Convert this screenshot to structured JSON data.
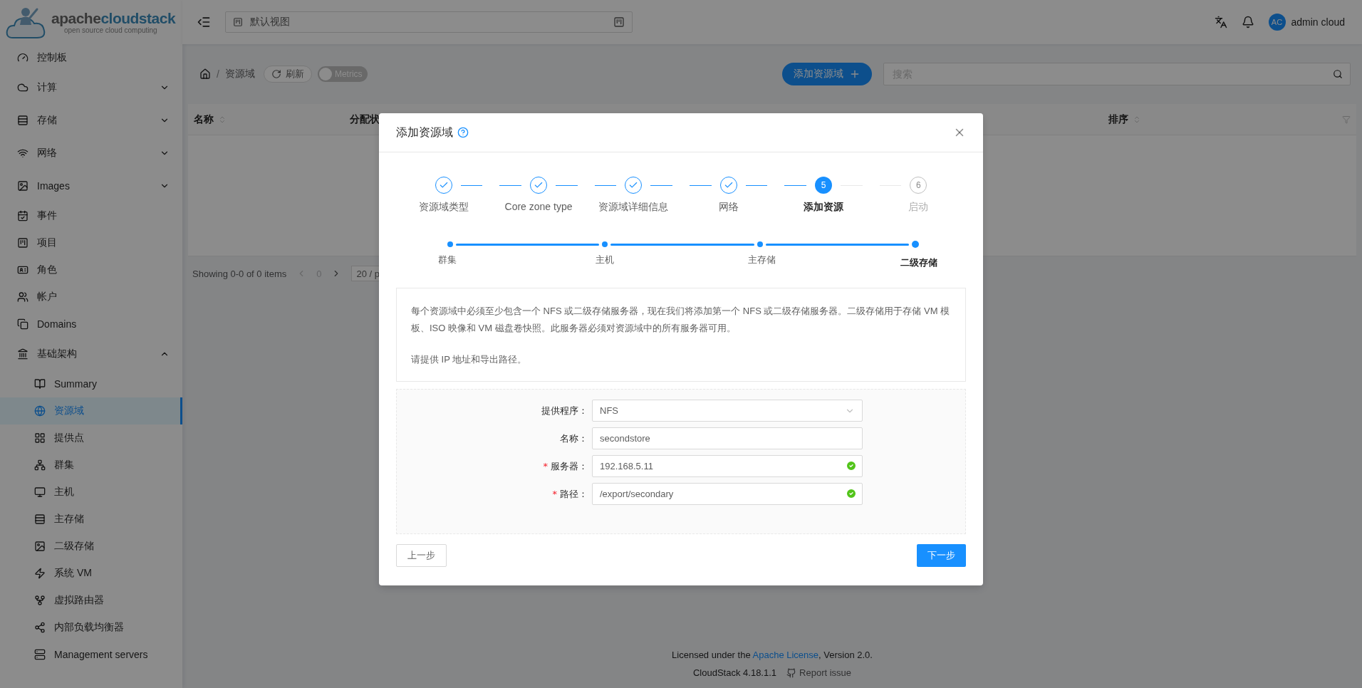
{
  "sidebar": {
    "logo": {
      "word_part1": "apache",
      "word_part2": "cloudstack",
      "tagline": "open source cloud computing"
    },
    "items": [
      {
        "label": "控制板",
        "selected": false
      },
      {
        "label": "计算",
        "selected": false,
        "expanded": false
      },
      {
        "label": "存储",
        "selected": false,
        "expanded": false
      },
      {
        "label": "网络",
        "selected": false,
        "expanded": false
      },
      {
        "label": "Images",
        "selected": false,
        "expanded": false
      },
      {
        "label": "事件",
        "selected": false
      },
      {
        "label": "项目",
        "selected": false
      },
      {
        "label": "角色",
        "selected": false
      },
      {
        "label": "帐户",
        "selected": false
      },
      {
        "label": "Domains",
        "selected": false
      },
      {
        "label": "基础架构",
        "selected": false,
        "expanded": true,
        "children": [
          {
            "label": "Summary",
            "selected": false
          },
          {
            "label": "资源域",
            "selected": true
          },
          {
            "label": "提供点",
            "selected": false
          },
          {
            "label": "群集",
            "selected": false
          },
          {
            "label": "主机",
            "selected": false
          },
          {
            "label": "主存储",
            "selected": false
          },
          {
            "label": "二级存储",
            "selected": false
          },
          {
            "label": "系统 VM",
            "selected": false
          },
          {
            "label": "虚拟路由器",
            "selected": false
          },
          {
            "label": "内部负载均衡器",
            "selected": false
          },
          {
            "label": "Management servers",
            "selected": false
          }
        ]
      }
    ]
  },
  "header": {
    "view_selector": {
      "value": "默认视图"
    },
    "user": {
      "initials": "AC",
      "name": "admin cloud"
    }
  },
  "toolbar": {
    "breadcrumb_separator": "/",
    "breadcrumb": [
      "资源域"
    ],
    "refresh": "刷新",
    "metrics": {
      "label": "Metrics",
      "on": false
    },
    "add_button": "添加资源域",
    "search": {
      "placeholder": "搜索"
    }
  },
  "table": {
    "columns": [
      {
        "label": "名称"
      },
      {
        "label": "分配状"
      },
      {
        "label": "排序"
      }
    ],
    "pagination": {
      "summary": "Showing 0-0 of 0 items",
      "page": "0",
      "page_size": "20 / p"
    }
  },
  "footer": {
    "license_before": "Licensed under the ",
    "license_link": "Apache License",
    "license_after": ", Version 2.0.",
    "version": "CloudStack 4.18.1.1",
    "report": "Report issue"
  },
  "modal": {
    "title": "添加资源域",
    "steps": [
      {
        "label": "资源域类型",
        "done": true,
        "current": false
      },
      {
        "label": "Core zone type",
        "done": true,
        "current": false
      },
      {
        "label": "资源域详细信息",
        "done": true,
        "current": false
      },
      {
        "label": "网络",
        "done": true,
        "current": false
      },
      {
        "label": "添加资源",
        "done": false,
        "current": true,
        "number": "5"
      },
      {
        "label": "启动",
        "done": false,
        "current": false,
        "number": "6"
      }
    ],
    "substeps": [
      {
        "label": "群集",
        "selected": false
      },
      {
        "label": "主机",
        "selected": false
      },
      {
        "label": "主存储",
        "selected": false
      },
      {
        "label": "二级存储",
        "selected": true
      }
    ],
    "description": [
      "每个资源域中必须至少包含一个 NFS 或二级存储服务器，现在我们将添加第一个 NFS 或二级存储服务器。二级存储用于存储 VM 模板、ISO 映像和 VM 磁盘卷快照。此服务器必须对资源域中的所有服务器可用。",
      "请提供 IP 地址和导出路径。"
    ],
    "fields": [
      {
        "kind": "select",
        "label": "提供程序：",
        "value": "NFS",
        "valid": false
      },
      {
        "kind": "input",
        "label": "名称：",
        "value": "secondstore",
        "valid": false
      },
      {
        "kind": "input",
        "required_mark": "*",
        "label": "服务器：",
        "value": "192.168.5.11",
        "valid": true
      },
      {
        "kind": "input",
        "required_mark": "*",
        "label": "路径：",
        "value": "/export/secondary",
        "valid": true
      }
    ],
    "prev_button": "上一步",
    "next_button": "下一步"
  }
}
